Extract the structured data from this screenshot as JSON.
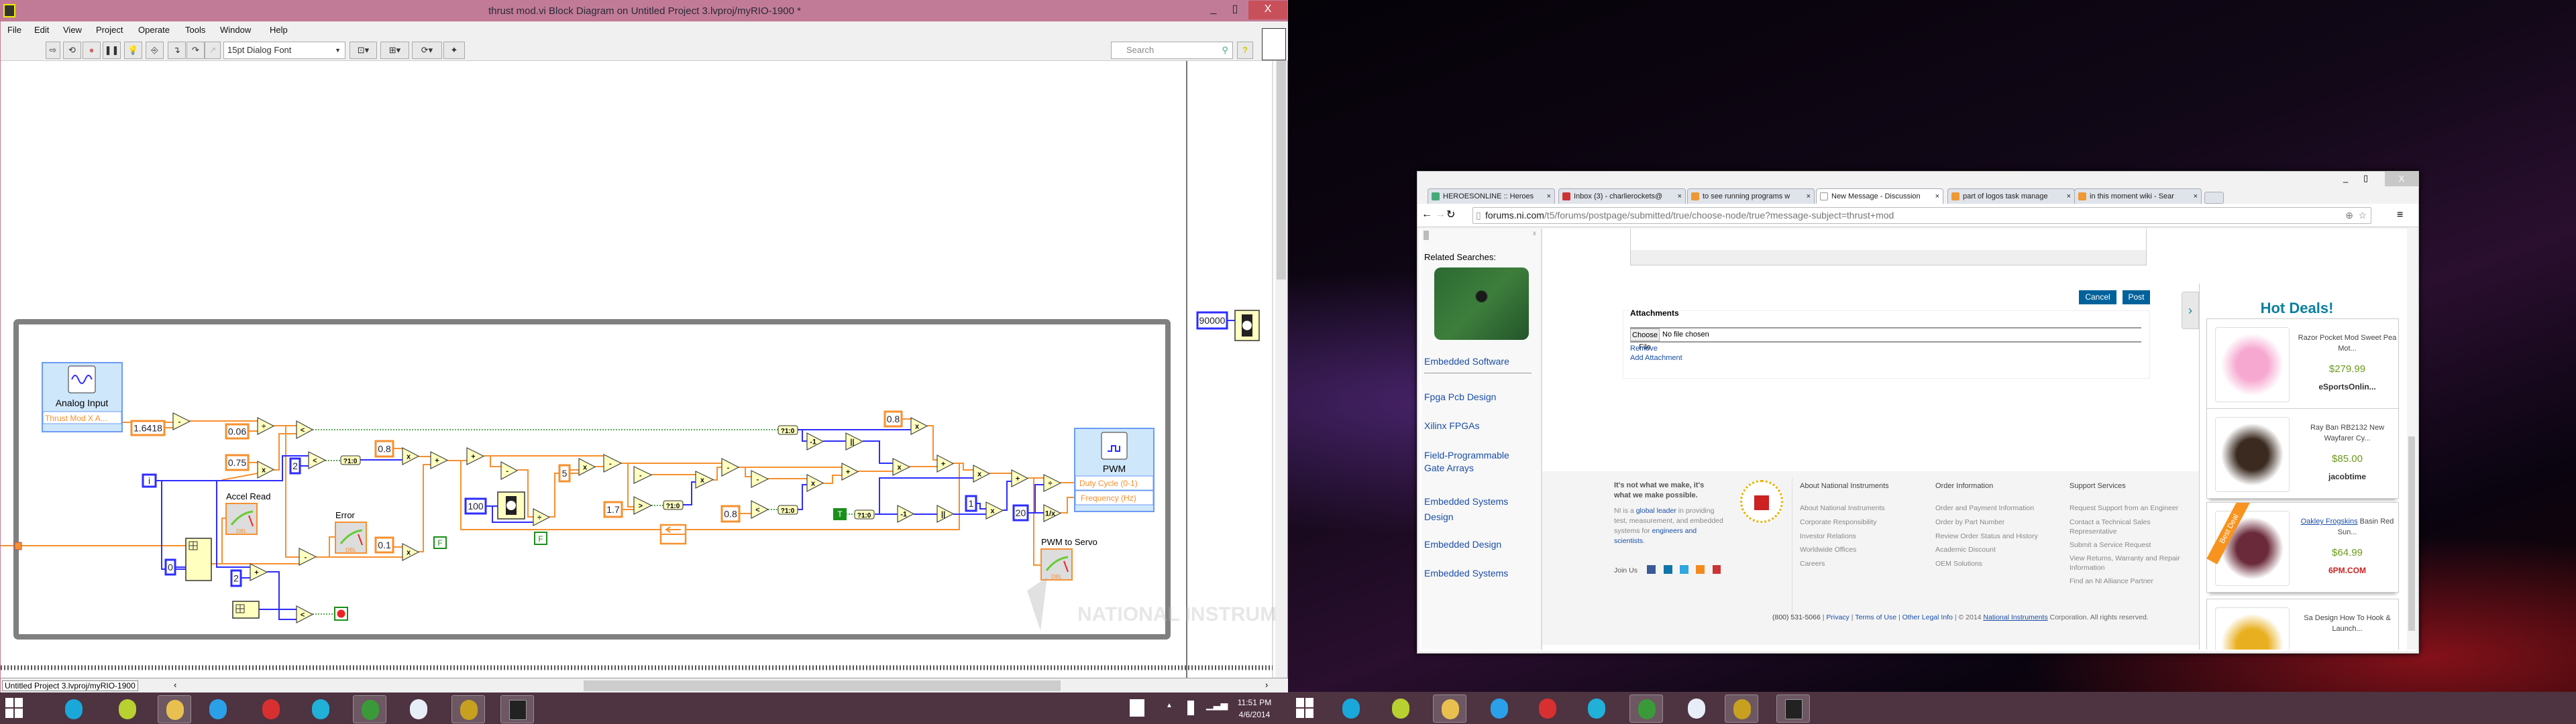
{
  "labview": {
    "title": "thrust mod.vi Block Diagram on Untitled Project 3.lvproj/myRIO-1900 *",
    "menu": [
      "File",
      "Edit",
      "View",
      "Project",
      "Operate",
      "Tools",
      "Window",
      "Help"
    ],
    "font_dropdown": "15pt Dialog Font",
    "search_placeholder": "Search",
    "status_path": "Untitled Project 3.lvproj/myRIO-1900",
    "diagram": {
      "analog_input": {
        "title": "Analog Input",
        "channel": "Thrust Mod X A..."
      },
      "pwm": {
        "title": "PWM",
        "inputs": [
          "Duty Cycle (0-1)",
          "Frequency (Hz)"
        ]
      },
      "indicators": [
        "Accel Read",
        "Error",
        "PWM to Servo"
      ],
      "gauge_tag": "DBL",
      "constants": [
        "1.6418",
        "0.06",
        "0.75",
        "i",
        "2",
        "0.8",
        "100",
        "5",
        "1.7",
        "0.1",
        "0",
        "2",
        "0.8",
        "0.8",
        "1",
        "20",
        "90000"
      ],
      "booleans": [
        "F",
        "F",
        "T"
      ],
      "operators": [
        "-",
        "÷",
        "<",
        "x",
        "<",
        "x",
        "+",
        "+",
        "-",
        "÷",
        "x",
        "-",
        "-",
        ">",
        "x",
        "-",
        "-",
        "<",
        "x",
        "+",
        "-1",
        "||",
        "x",
        "x",
        "+",
        "x",
        "+",
        "÷",
        "1/x",
        "x",
        "||",
        "-1",
        "x",
        "-",
        "+",
        "<"
      ],
      "select_label": "?1:0",
      "watermark": "NATIONAL INSTRUMENTS"
    }
  },
  "taskbar_left": {
    "time": "11:51 PM",
    "date": "4/6/2014",
    "icons": [
      "media-center",
      "media-player",
      "file-explorer",
      "internet-explorer",
      "app-red",
      "app-disc",
      "chrome",
      "document-app",
      "labview",
      "terminal"
    ]
  },
  "browser": {
    "tabs": [
      "HEROESONLINE :: Heroes",
      "Inbox (3) - charlierockets@",
      "to see running programs w",
      "New Message - Discussion",
      "part of logos task manage",
      "in this moment wiki - Sear"
    ],
    "active_tab": 3,
    "url_domain": "forums.ni.com",
    "url_path": "/t5/forums/postpage/submitted/true/choose-node/true?message-subject=thrust+mod",
    "sidebar": {
      "heading": "Related Searches:",
      "links": [
        "Embedded Software",
        "Fpga Pcb Design",
        "Xilinx FPGAs",
        "Field-Programmable Gate Arrays",
        "Embedded Systems Design",
        "Embedded Design",
        "Embedded Systems"
      ]
    },
    "form": {
      "cancel": "Cancel",
      "post": "Post",
      "attachments": "Attachments",
      "choose_file": "Choose File",
      "no_file": "No file chosen",
      "remove": "Remove",
      "add_attachment": "Add Attachment"
    },
    "footer": {
      "tagline": "It's not what we make, it's what we make possible.",
      "blurb_pre": "NI is a ",
      "blurb_link1": "global leader",
      "blurb_mid": " in providing test, measurement, and embedded systems for ",
      "blurb_link2": "engineers and scientists",
      "blurb_end": ".",
      "join_us": "Join Us",
      "columns": [
        {
          "title": "About National Instruments",
          "items": [
            "About National Instruments",
            "Corporate Responsibility",
            "Investor Relations",
            "Worldwide Offices",
            "Careers"
          ]
        },
        {
          "title": "Order Information",
          "items": [
            "Order and Payment Information",
            "Order by Part Number",
            "Review Order Status and History",
            "Academic Discount",
            "OEM Solutions"
          ]
        },
        {
          "title": "Support Services",
          "items": [
            "Request Support from an Engineer",
            "Contact a Technical Sales Representative",
            "Submit a Service Request",
            "View Returns, Warranty and Repair Information",
            "Find an NI Alliance Partner"
          ]
        }
      ],
      "phone": "(800) 531-5066",
      "privacy": "Privacy",
      "terms": "Terms of Use",
      "legal": "Other Legal Info",
      "copyright_pre": "© 2014 ",
      "copyright_link": "National Instruments",
      "copyright_post": " Corporation. All rights reserved."
    },
    "deals": {
      "title": "Hot Deals!",
      "ribbon": "Best Deal",
      "items": [
        {
          "name": "Razor Pocket Mod Sweet Pea Mot...",
          "price": "$279.99",
          "store": "eSportsOnlin..."
        },
        {
          "name": "Ray Ban RB2132 New Wayfarer Cy...",
          "price": "$85.00",
          "store": "jacobtime"
        },
        {
          "name_link": "Oakley Frogskins",
          "name": " Basin Red Sun...",
          "price": "$64.99",
          "store": "6PM.COM"
        },
        {
          "name": "Sa Design How To Hook & Launch..."
        }
      ]
    }
  },
  "taskbar_right": {
    "icons": [
      "media-center",
      "media-player",
      "file-explorer",
      "internet-explorer",
      "app-red",
      "app-disc",
      "chrome",
      "document-app",
      "labview",
      "terminal"
    ]
  },
  "colors": {
    "labview_title": "#c27b96",
    "dbl_wire": "#f7902f",
    "int_wire": "#2d2dff",
    "bool_wire": "#1a8f1a",
    "ni_blue": "#00629b",
    "deal_title": "#0a7fa0",
    "price_green": "#6a9a1a"
  }
}
